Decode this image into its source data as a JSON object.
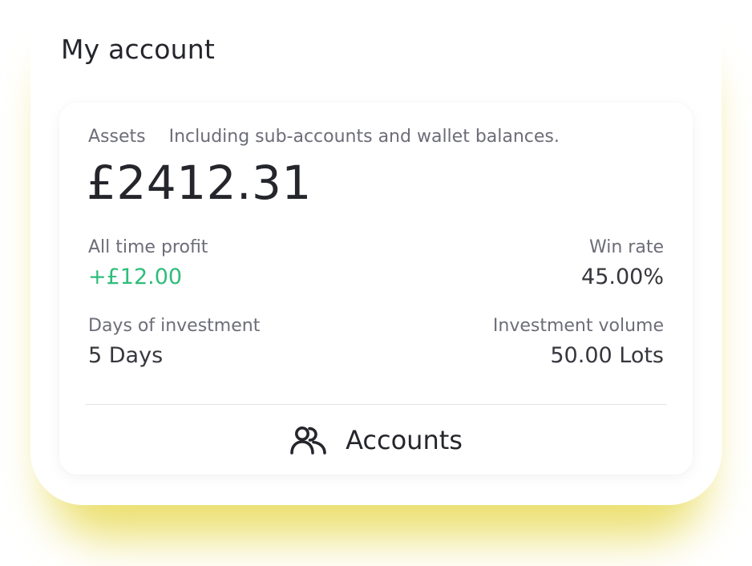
{
  "card": {
    "title": "My account"
  },
  "assets": {
    "label": "Assets",
    "note": "Including sub-accounts and wallet balances.",
    "total": "£2412.31"
  },
  "stats": {
    "all_time_profit": {
      "label": "All time profit",
      "value": "+£12.00"
    },
    "win_rate": {
      "label": "Win rate",
      "value": "45.00%"
    },
    "days_of_investment": {
      "label": "Days of investment",
      "value": "5 Days"
    },
    "investment_volume": {
      "label": "Investment volume",
      "value": "50.00 Lots"
    }
  },
  "accounts_button": {
    "label": "Accounts",
    "icon": "users-icon"
  },
  "colors": {
    "accent_glow": "#e4d43c",
    "positive": "#2ebd7a",
    "text_primary": "#25262c",
    "text_secondary": "#6c6d78"
  }
}
